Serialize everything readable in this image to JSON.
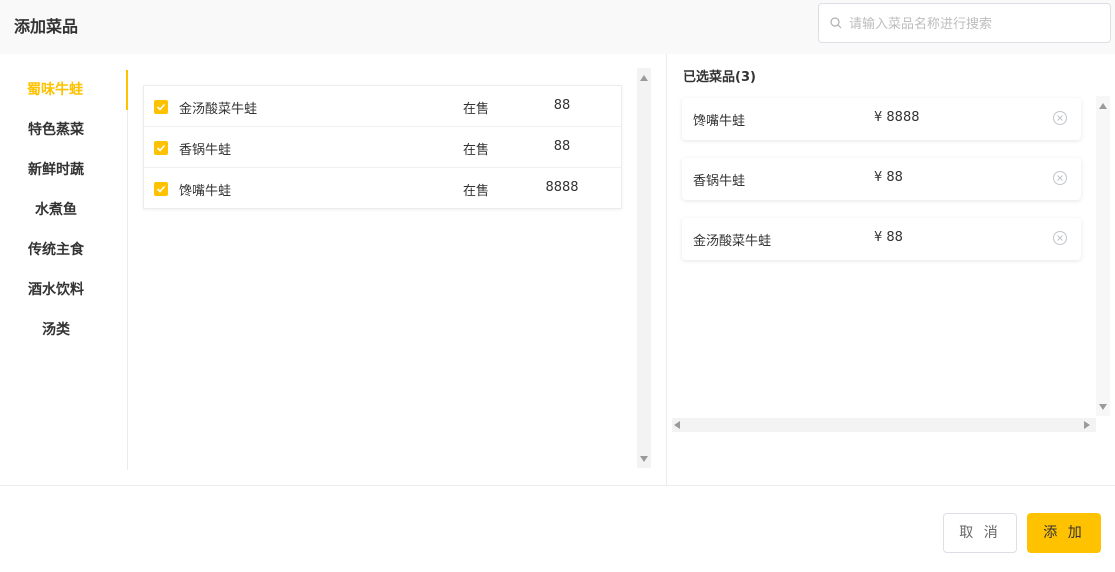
{
  "header": {
    "title": "添加菜品"
  },
  "search": {
    "placeholder": "请输入菜品名称进行搜索",
    "value": ""
  },
  "categories": [
    "蜀味牛蛙",
    "特色蒸菜",
    "新鲜时蔬",
    "水煮鱼",
    "传统主食",
    "酒水饮料",
    "汤类"
  ],
  "active_category": "蜀味牛蛙",
  "dishes": [
    {
      "name": "金汤酸菜牛蛙",
      "status": "在售",
      "price": "88",
      "checked": true
    },
    {
      "name": "香锅牛蛙",
      "status": "在售",
      "price": "88",
      "checked": true
    },
    {
      "name": "馋嘴牛蛙",
      "status": "在售",
      "price": "8888",
      "checked": true
    }
  ],
  "selected": {
    "title": "已选菜品(3)",
    "items": [
      {
        "name": "馋嘴牛蛙",
        "price": "¥ 8888"
      },
      {
        "name": "香锅牛蛙",
        "price": "¥ 88"
      },
      {
        "name": "金汤酸菜牛蛙",
        "price": "¥ 88"
      }
    ]
  },
  "footer": {
    "cancel_label": "取 消",
    "add_label": "添 加"
  },
  "colors": {
    "accent": "#ffc200",
    "border": "#ececec",
    "text": "#333333"
  },
  "icons": {
    "search": "search-icon",
    "check": "check-icon",
    "remove": "close-circle-icon"
  }
}
